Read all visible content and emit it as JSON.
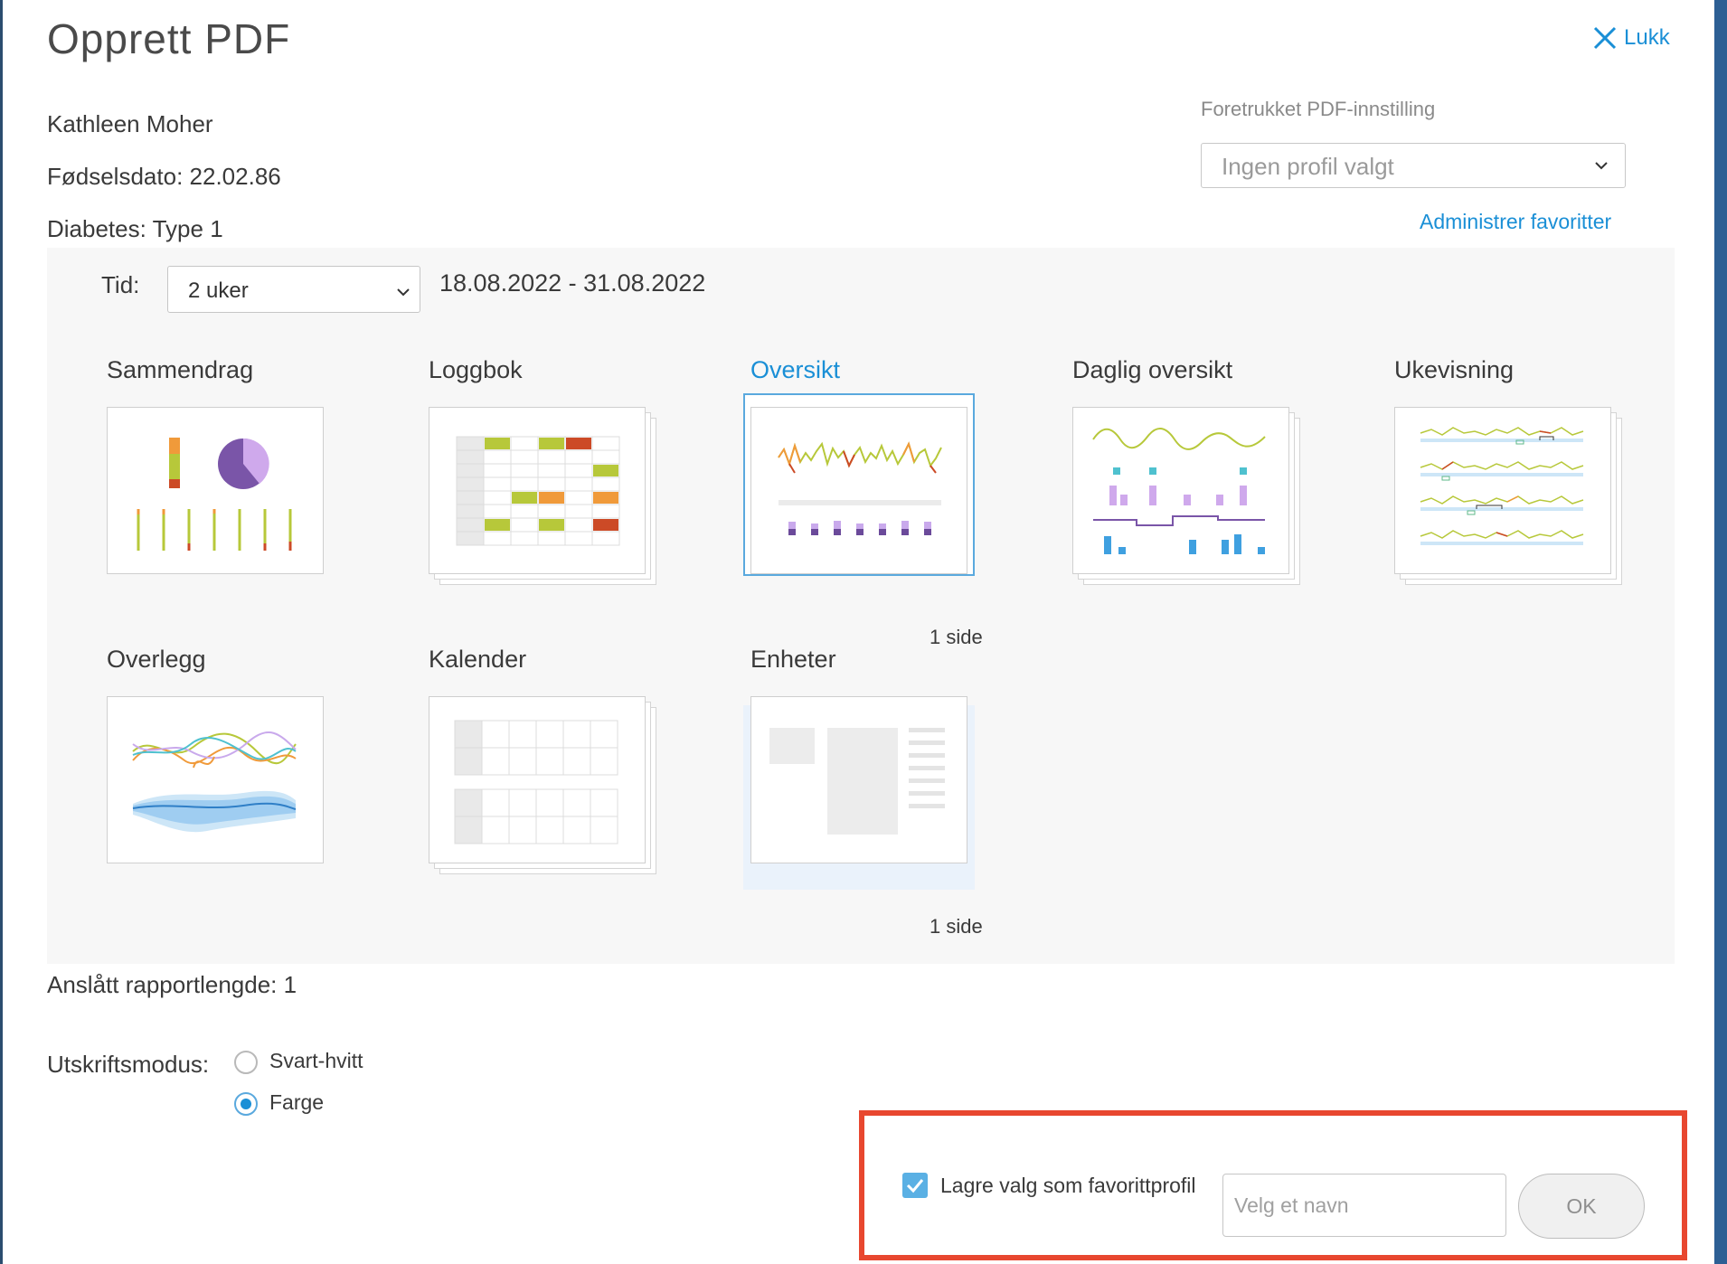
{
  "dialog": {
    "title": "Opprett PDF",
    "close_label": "Lukk"
  },
  "patient": {
    "name": "Kathleen Moher",
    "dob_label": "Fødselsdato:",
    "dob_value": "22.02.86",
    "diabetes_label": "Diabetes:",
    "diabetes_value": "Type 1"
  },
  "preferred": {
    "label": "Foretrukket PDF-innstilling",
    "selected": "Ingen profil valgt",
    "manage_link": "Administrer favoritter"
  },
  "time": {
    "label": "Tid:",
    "selected": "2 uker",
    "range": "18.08.2022 - 31.08.2022"
  },
  "reports": [
    {
      "title": "Sammendrag",
      "selected": false
    },
    {
      "title": "Loggbok",
      "selected": false
    },
    {
      "title": "Oversikt",
      "selected": true,
      "pages": "1 side"
    },
    {
      "title": "Daglig oversikt",
      "selected": false
    },
    {
      "title": "Ukevisning",
      "selected": false
    },
    {
      "title": "Overlegg",
      "selected": false
    },
    {
      "title": "Kalender",
      "selected": false
    },
    {
      "title": "Enheter",
      "selected": false,
      "pages": "1 side"
    }
  ],
  "report_length": "Anslått rapportlengde: 1",
  "print_mode": {
    "label": "Utskriftsmodus:",
    "options": [
      {
        "label": "Svart-hvitt",
        "checked": false
      },
      {
        "label": "Farge",
        "checked": true
      }
    ]
  },
  "favorite": {
    "checkbox_label": "Lagre valg som favorittprofil",
    "checked": true,
    "name_placeholder": "Velg et navn",
    "ok_label": "OK"
  },
  "colors": {
    "accent": "#1a8fd6",
    "highlight": "#e8472f",
    "green": "#b7c83a",
    "orange": "#f09a3a",
    "red": "#cc4a26",
    "purple": "#8a63b8"
  }
}
